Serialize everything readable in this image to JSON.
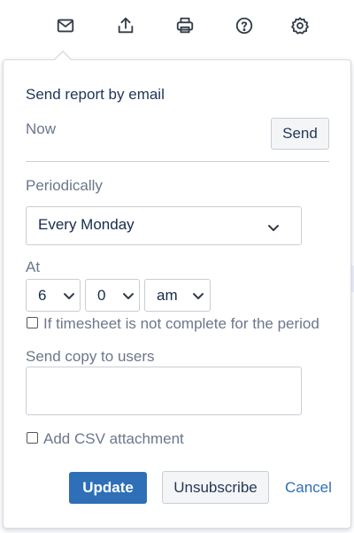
{
  "toolbar": {
    "icons": [
      "mail-icon",
      "export-icon",
      "print-icon",
      "help-icon",
      "settings-icon"
    ]
  },
  "popup": {
    "title": "Send report by email",
    "now_label": "Now",
    "send_label": "Send",
    "periodically_label": "Periodically",
    "period_value": "Every Monday",
    "at_label": "At",
    "hour_value": "6",
    "minute_value": "0",
    "ampm_value": "am",
    "incomplete_label": "If timesheet is not complete for the period",
    "copy_label": "Send copy to users",
    "csv_label": "Add CSV attachment",
    "update_label": "Update",
    "unsubscribe_label": "Unsubscribe",
    "cancel_label": "Cancel"
  },
  "colors": {
    "accent": "#2e6fb7",
    "muted_text": "#6b778c",
    "border": "#c9ced6"
  }
}
